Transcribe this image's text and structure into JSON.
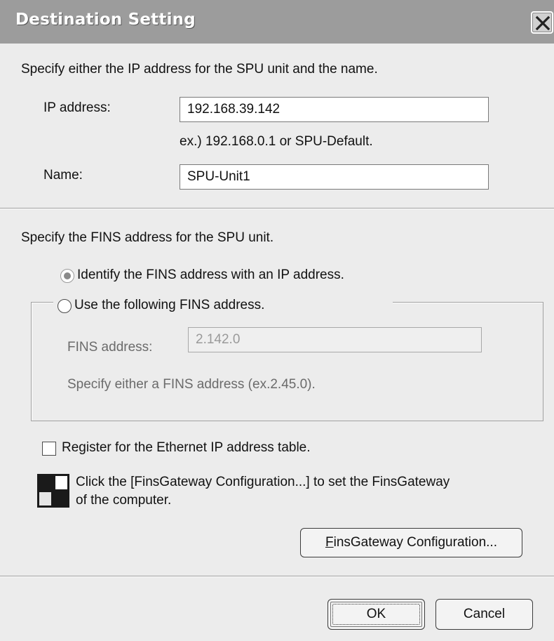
{
  "window": {
    "title": "Destination Setting",
    "close_icon": "close-icon"
  },
  "spu": {
    "instruction": "Specify either the IP address for the SPU unit and the name.",
    "ip_label": "IP address:",
    "ip_value": "192.168.39.142",
    "ip_example": "ex.) 192.168.0.1 or SPU-Default.",
    "name_label": "Name:",
    "name_value": "SPU-Unit1"
  },
  "fins": {
    "instruction": "Specify the FINS address for the SPU unit.",
    "radio_identify_label": "Identify the FINS address with an IP address.",
    "radio_identify_checked": true,
    "radio_use_label": "Use the following FINS address.",
    "radio_use_checked": false,
    "address_label": "FINS address:",
    "address_value": "2.142.0",
    "address_hint": "Specify either a FINS address (ex.2.45.0)."
  },
  "register": {
    "checkbox_label": "Register for the Ethernet IP address table.",
    "checked": false
  },
  "info": {
    "icon": "finsgateway-icon",
    "line1": "Click the [FinsGateway Configuration...] to set the FinsGateway",
    "line2": "of the computer.",
    "config_button_mnemonic": "F",
    "config_button_rest": "insGateway Configuration..."
  },
  "footer": {
    "ok_label": "OK",
    "cancel_label": "Cancel"
  },
  "colors": {
    "title_bar": "#9c9c9c",
    "dialog_bg": "#ececec"
  }
}
